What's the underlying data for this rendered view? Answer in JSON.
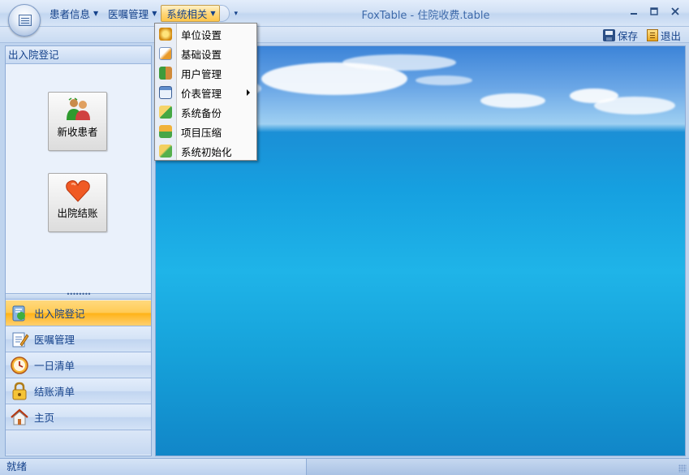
{
  "window": {
    "title": "FoxTable - 住院收费.table",
    "controls": [
      "minimize",
      "maximize",
      "close"
    ]
  },
  "menubar": {
    "items": [
      {
        "label": "患者信息"
      },
      {
        "label": "医嘱管理"
      },
      {
        "label": "系统相关",
        "active": true
      }
    ]
  },
  "toolbar": {
    "save_label": "保存",
    "exit_label": "退出"
  },
  "dropdown": {
    "items": [
      {
        "label": "单位设置",
        "icon": "gear-icon"
      },
      {
        "label": "基础设置",
        "icon": "pencil-icon"
      },
      {
        "label": "用户管理",
        "icon": "users-icon"
      },
      {
        "label": "价表管理",
        "icon": "window-icon",
        "has_submenu": true
      },
      {
        "label": "系统备份",
        "icon": "backup-icon"
      },
      {
        "label": "项目压缩",
        "icon": "compress-icon"
      },
      {
        "label": "系统初始化",
        "icon": "init-icon"
      }
    ]
  },
  "nav": {
    "header": "出入院登记",
    "buttons": [
      {
        "label": "新收患者",
        "icon": "patients-icon"
      },
      {
        "label": "出院结账",
        "icon": "heart-icon"
      }
    ],
    "groups": [
      {
        "label": "出入院登记",
        "icon": "register-icon",
        "selected": true
      },
      {
        "label": "医嘱管理",
        "icon": "notepad-icon"
      },
      {
        "label": "一日清单",
        "icon": "clock-icon"
      },
      {
        "label": "结账清单",
        "icon": "lock-icon"
      },
      {
        "label": "主页",
        "icon": "home-icon"
      }
    ]
  },
  "status": {
    "text": "就绪"
  },
  "colors": {
    "accent": "#ffc64a",
    "frame": "#bfd4ee",
    "text": "#15428b"
  }
}
